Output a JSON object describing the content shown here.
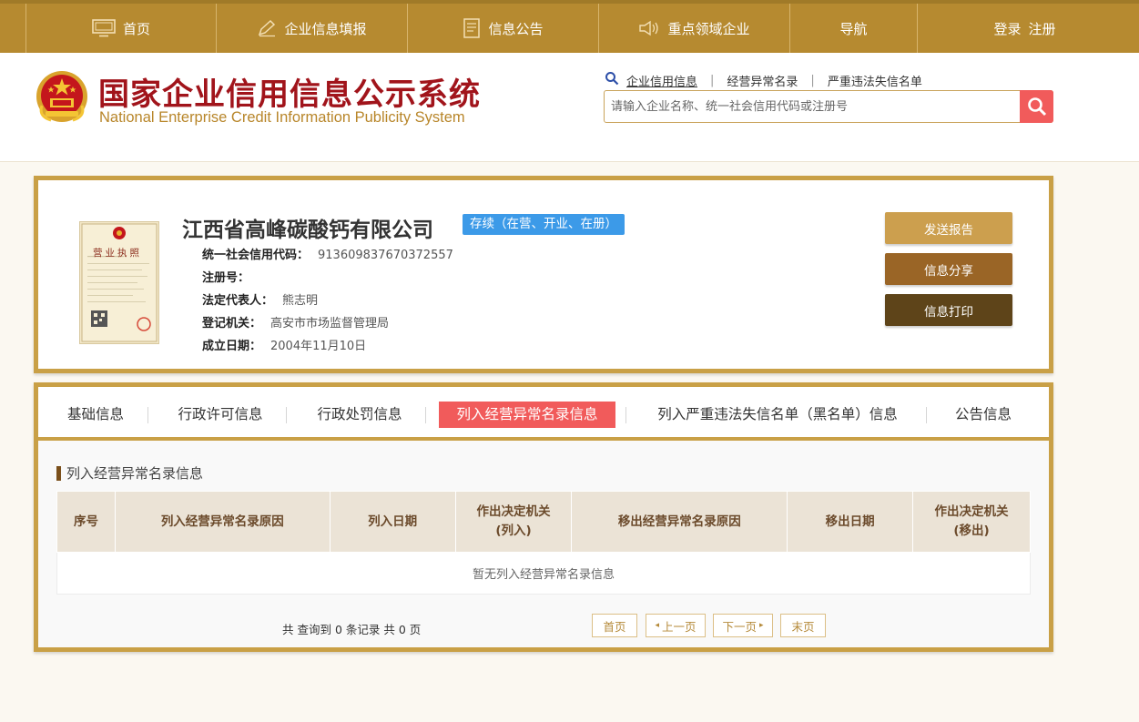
{
  "nav": {
    "items": [
      {
        "label": "首页",
        "icon": "monitor-icon"
      },
      {
        "label": "企业信息填报",
        "icon": "pen-icon"
      },
      {
        "label": "信息公告",
        "icon": "document-icon"
      },
      {
        "label": "重点领域企业",
        "icon": "speaker-icon"
      },
      {
        "label": "导航"
      }
    ],
    "login": "登录",
    "register": "注册"
  },
  "header": {
    "title_cn": "国家企业信用信息公示系统",
    "title_en": "National Enterprise Credit Information Publicity System",
    "search_tabs": [
      "企业信用信息",
      "经营异常名录",
      "严重违法失信名单"
    ],
    "search_placeholder": "请输入企业名称、统一社会信用代码或注册号"
  },
  "company": {
    "name": "江西省高峰碳酸钙有限公司",
    "status": "存续（在营、开业、在册）",
    "fields": [
      {
        "k": "统一社会信用代码：",
        "v": "913609837670372557"
      },
      {
        "k": "注册号：",
        "v": ""
      },
      {
        "k": "法定代表人：",
        "v": "熊志明"
      },
      {
        "k": "登记机关：",
        "v": "高安市市场监督管理局"
      },
      {
        "k": "成立日期：",
        "v": "2004年11月10日"
      }
    ],
    "license_title": "营业执照",
    "buttons": {
      "send": "发送报告",
      "share": "信息分享",
      "print": "信息打印"
    },
    "colors": {
      "send": "#cc9f4e",
      "share": "#9a6526",
      "print": "#5e4419"
    }
  },
  "tabs": [
    "基础信息",
    "行政许可信息",
    "行政处罚信息",
    "列入经营异常名录信息",
    "列入严重违法失信名单（黑名单）信息",
    "公告信息"
  ],
  "section": {
    "title": "列入经营异常名录信息",
    "columns": [
      "序号",
      "列入经营异常名录原因",
      "列入日期",
      "作出决定机关\n(列入)",
      "移出经营异常名录原因",
      "移出日期",
      "作出决定机关\n(移出)"
    ],
    "empty_text": "暂无列入经营异常名录信息"
  },
  "pager": {
    "summary": "共 查询到 0 条记录 共 0 页",
    "first": "首页",
    "prev": "上一页",
    "next": "下一页",
    "last": "末页"
  }
}
